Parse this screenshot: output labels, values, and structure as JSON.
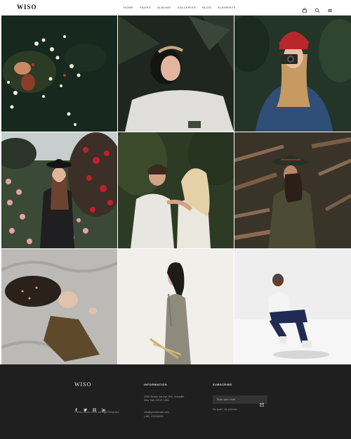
{
  "header": {
    "logo": "WISO",
    "nav": [
      "HOME",
      "PAGES",
      "ALBUMS",
      "GALLERIES",
      "BLOG",
      "ELEMENTS"
    ],
    "icons": [
      "bag-icon",
      "search-icon",
      "menu-icon"
    ]
  },
  "gallery": {
    "tiles": [
      {
        "name": "tile-flowers-water"
      },
      {
        "name": "tile-woman-lying-leaves"
      },
      {
        "name": "tile-woman-camera"
      },
      {
        "name": "tile-woman-rose-garden"
      },
      {
        "name": "tile-couple-embrace"
      },
      {
        "name": "tile-woman-hat-branches"
      },
      {
        "name": "tile-woman-lying-bed"
      },
      {
        "name": "tile-woman-grey-dress"
      },
      {
        "name": "tile-man-sitting-white"
      }
    ]
  },
  "footer": {
    "logo": "WISO",
    "copyright": "© Wiso Studio 2018. All Right Reserved.",
    "information": {
      "heading": "INFORMATION",
      "address_line1": "2005 Stokes Isle Apt. 896, Venaville,",
      "address_line2": "New York 10010, USA",
      "email": "info@yourdomain.com",
      "phone": "(+68) 120034509"
    },
    "subscribe": {
      "heading": "SUBSCRIBE",
      "placeholder": "Enter your email",
      "note": "No spam, we promise"
    },
    "socials": [
      "facebook-icon",
      "twitter-icon",
      "instagram-icon",
      "linkedin-icon"
    ]
  }
}
